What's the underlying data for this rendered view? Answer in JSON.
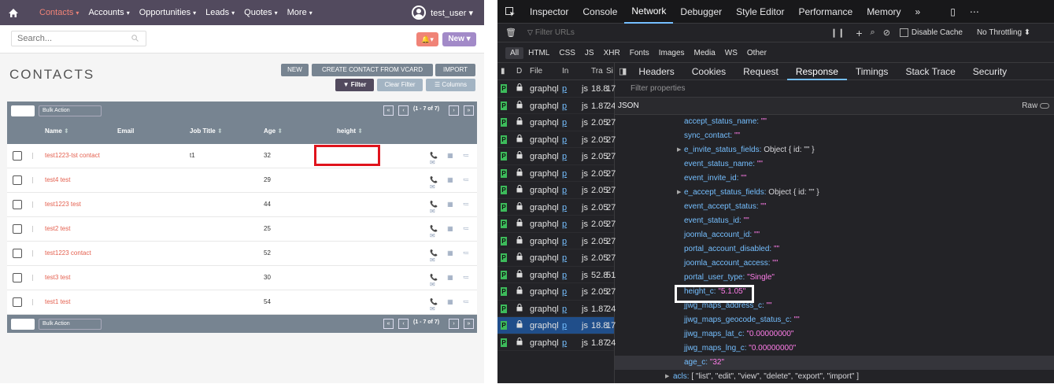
{
  "crm": {
    "nav": {
      "items": [
        {
          "label": "Contacts",
          "arrow": "▾",
          "active": true
        },
        {
          "label": "Accounts",
          "arrow": "▾"
        },
        {
          "label": "Opportunities",
          "arrow": "▾"
        },
        {
          "label": "Leads",
          "arrow": "▾"
        },
        {
          "label": "Quotes",
          "arrow": "▾"
        },
        {
          "label": "More",
          "arrow": "▾"
        }
      ],
      "user": "test_user ▾"
    },
    "search_placeholder": "Search...",
    "alert_label": "🔔▾",
    "new_label": "New ▾",
    "title": "CONTACTS",
    "actions": {
      "new": "NEW",
      "vcard": "CREATE CONTACT FROM VCARD",
      "import": "IMPORT",
      "filter": "▼ Filter",
      "clear": "Clear Filter",
      "columns": "☰ Columns"
    },
    "bulk_action": "Bulk Action",
    "page_info": "(1 - 7 of 7)",
    "columns": [
      "Name",
      "Email",
      "Job Title",
      "Age",
      "height"
    ],
    "sort_glyph": "⬍",
    "rows": [
      {
        "name": "test1223-tst contact",
        "job": "t1",
        "age": "32"
      },
      {
        "name": "test4 test",
        "job": "",
        "age": "29"
      },
      {
        "name": "test1223 test",
        "job": "",
        "age": "44"
      },
      {
        "name": "test2 test",
        "job": "",
        "age": "25"
      },
      {
        "name": "test1223 contact",
        "job": "",
        "age": "52"
      },
      {
        "name": "test3 test",
        "job": "",
        "age": "30"
      },
      {
        "name": "test1 test",
        "job": "",
        "age": "54"
      }
    ],
    "row_icons": "📞 ▦ ≔ ✉"
  },
  "devtools": {
    "tabs": [
      "Inspector",
      "Console",
      "Network",
      "Debugger",
      "Style Editor",
      "Performance",
      "Memory"
    ],
    "active_tab": "Network",
    "filter_placeholder": "Filter URLs",
    "disable_cache": "Disable Cache",
    "throttling": "No Throttling ⬍",
    "types": [
      "All",
      "HTML",
      "CSS",
      "JS",
      "XHR",
      "Fonts",
      "Images",
      "Media",
      "WS",
      "Other"
    ],
    "req_headers": {
      "d": "D",
      "file": "File",
      "ini": "In",
      "tr": "Tra",
      "s": "Si"
    },
    "requests": [
      {
        "file": "graphql",
        "ini": "p",
        "ty": "js",
        "tr": "18.8",
        "sz": "17"
      },
      {
        "file": "graphql",
        "ini": "p",
        "ty": "js",
        "tr": "1.87",
        "sz": "24"
      },
      {
        "file": "graphql",
        "ini": "p",
        "ty": "js",
        "tr": "2.05",
        "sz": "27"
      },
      {
        "file": "graphql",
        "ini": "p",
        "ty": "js",
        "tr": "2.05",
        "sz": "27"
      },
      {
        "file": "graphql",
        "ini": "p",
        "ty": "js",
        "tr": "2.05",
        "sz": "27"
      },
      {
        "file": "graphql",
        "ini": "p",
        "ty": "js",
        "tr": "2.05",
        "sz": "27"
      },
      {
        "file": "graphql",
        "ini": "p",
        "ty": "js",
        "tr": "2.05",
        "sz": "27"
      },
      {
        "file": "graphql",
        "ini": "p",
        "ty": "js",
        "tr": "2.05",
        "sz": "27"
      },
      {
        "file": "graphql",
        "ini": "p",
        "ty": "js",
        "tr": "2.05",
        "sz": "27"
      },
      {
        "file": "graphql",
        "ini": "p",
        "ty": "js",
        "tr": "2.05",
        "sz": "27"
      },
      {
        "file": "graphql",
        "ini": "p",
        "ty": "js",
        "tr": "2.05",
        "sz": "27"
      },
      {
        "file": "graphql",
        "ini": "p",
        "ty": "js",
        "tr": "52.8",
        "sz": "51"
      },
      {
        "file": "graphql",
        "ini": "p",
        "ty": "js",
        "tr": "2.05",
        "sz": "27"
      },
      {
        "file": "graphql",
        "ini": "p",
        "ty": "js",
        "tr": "1.87",
        "sz": "24"
      },
      {
        "file": "graphql",
        "ini": "p",
        "ty": "js",
        "tr": "18.8",
        "sz": "17",
        "selected": true
      },
      {
        "file": "graphql",
        "ini": "p",
        "ty": "js",
        "tr": "1.87",
        "sz": "24"
      }
    ],
    "detail_tabs": [
      "Headers",
      "Cookies",
      "Request",
      "Response",
      "Timings",
      "Stack Trace",
      "Security"
    ],
    "active_detail": "Response",
    "prop_filter": "Filter properties",
    "json_label": "JSON",
    "raw_label": "Raw",
    "json": [
      {
        "k": "accept_status_name:",
        "v": "\"\""
      },
      {
        "k": "sync_contact:",
        "v": "\"\""
      },
      {
        "k": "e_invite_status_fields:",
        "o": "Object { id: \"\" }",
        "tw": true
      },
      {
        "k": "event_status_name:",
        "v": "\"\""
      },
      {
        "k": "event_invite_id:",
        "v": "\"\""
      },
      {
        "k": "e_accept_status_fields:",
        "o": "Object { id: \"\" }",
        "tw": true
      },
      {
        "k": "event_accept_status:",
        "v": "\"\""
      },
      {
        "k": "event_status_id:",
        "v": "\"\""
      },
      {
        "k": "joomla_account_id:",
        "v": "\"\""
      },
      {
        "k": "portal_account_disabled:",
        "v": "\"\""
      },
      {
        "k": "joomla_account_access:",
        "v": "\"\""
      },
      {
        "k": "portal_user_type:",
        "v": "\"Single\""
      },
      {
        "k": "height_c:",
        "v": "\"5.1.05\""
      },
      {
        "k": "jjwg_maps_address_c:",
        "v": "\"\""
      },
      {
        "k": "jjwg_maps_geocode_status_c:",
        "v": "\"\""
      },
      {
        "k": "jjwg_maps_lat_c:",
        "v": "\"0.00000000\""
      },
      {
        "k": "jjwg_maps_lng_c:",
        "v": "\"0.00000000\""
      },
      {
        "k": "age_c:",
        "v": "\"32\"",
        "hover": true
      }
    ],
    "acls": {
      "k": "acls:",
      "o": "[ \"list\", \"edit\", \"view\", \"delete\", \"export\", \"import\" ]"
    }
  }
}
